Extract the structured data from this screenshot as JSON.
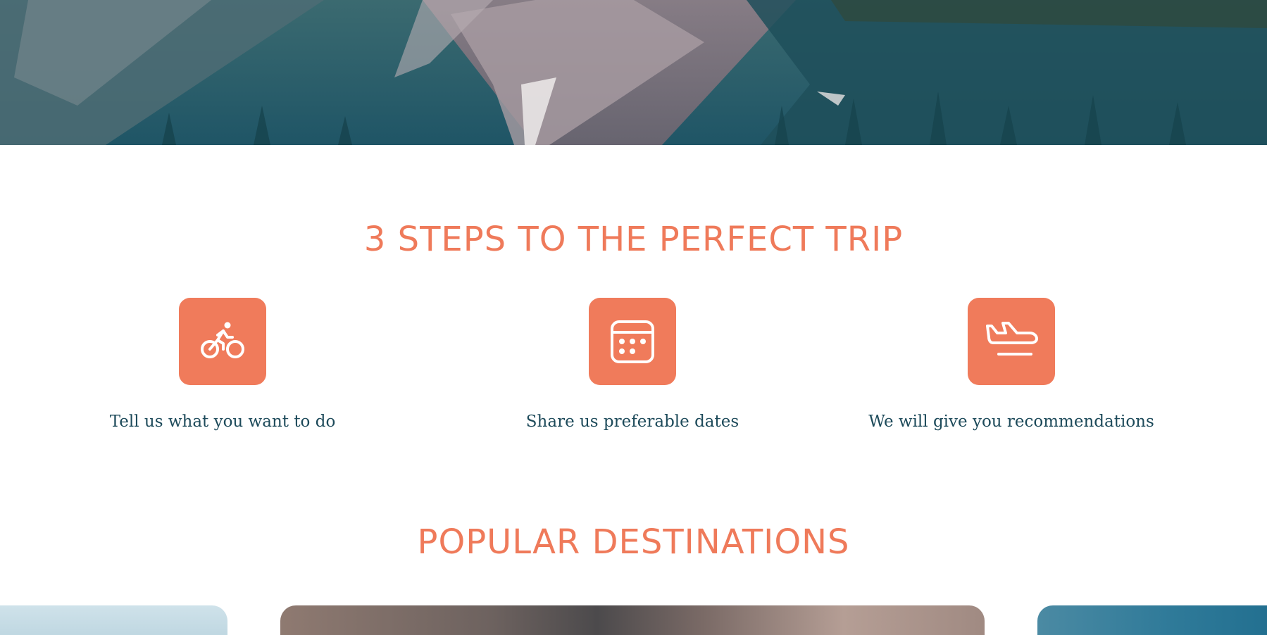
{
  "hero": {
    "image": "mountain-lake-reflection"
  },
  "steps_section": {
    "title": "3 STEPS TO THE PERFECT TRIP",
    "steps": [
      {
        "icon": "bicycle-rider-icon",
        "label": "Tell us what you want to do"
      },
      {
        "icon": "calendar-icon",
        "label": "Share us preferable dates"
      },
      {
        "icon": "airplane-landing-icon",
        "label": "We will give you recommendations"
      }
    ]
  },
  "destinations_section": {
    "title": "POPULAR DESTINATIONS"
  },
  "colors": {
    "accent": "#f07b5b",
    "heading": "#ef7a5a",
    "text": "#1d4a5a",
    "background": "#ffffff"
  }
}
